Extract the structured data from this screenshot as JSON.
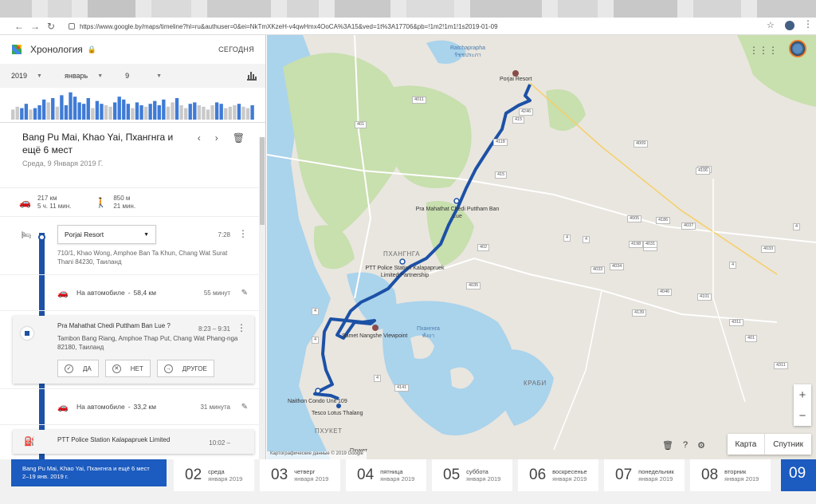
{
  "browser": {
    "url": "https://www.google.by/maps/timeline?hl=ru&authuser=0&ei=NkTmXKzeH-v4qwHmx4OoCA%3A15&ved=1t%3A17706&pb=!1m2!1m1!1s2019-01-09"
  },
  "header": {
    "title": "Хронология",
    "today_label": "СЕГОДНЯ"
  },
  "selectors": {
    "year": "2019",
    "month": "январь",
    "day": "9"
  },
  "histogram": {
    "values": [
      0.35,
      0.45,
      0.4,
      0.55,
      0.35,
      0.4,
      0.5,
      0.7,
      0.6,
      0.75,
      0.45,
      0.85,
      0.5,
      0.95,
      0.8,
      0.6,
      0.55,
      0.75,
      0.4,
      0.65,
      0.55,
      0.5,
      0.45,
      0.6,
      0.8,
      0.7,
      0.55,
      0.4,
      0.6,
      0.5,
      0.45,
      0.55,
      0.65,
      0.5,
      0.7,
      0.45,
      0.6,
      0.75,
      0.5,
      0.4,
      0.55,
      0.6,
      0.5,
      0.45,
      0.35,
      0.5,
      0.6,
      0.55,
      0.4,
      0.45,
      0.5,
      0.55,
      0.45,
      0.4,
      0.5
    ],
    "highlight": [
      false,
      false,
      true,
      true,
      false,
      true,
      true,
      true,
      false,
      true,
      false,
      true,
      true,
      true,
      true,
      true,
      true,
      true,
      false,
      true,
      true,
      false,
      false,
      true,
      true,
      true,
      true,
      false,
      true,
      true,
      false,
      true,
      true,
      true,
      true,
      false,
      false,
      true,
      false,
      false,
      true,
      true,
      false,
      false,
      false,
      false,
      true,
      true,
      false,
      false,
      false,
      true,
      false,
      false,
      true
    ]
  },
  "day": {
    "title": "Bang Pu Mai, Khao Yai, Пхангнга и ещё 6 мест",
    "date": "Среда, 9 Января 2019 Г.",
    "drive_distance": "217 км",
    "drive_duration": "5 ч. 11 мин.",
    "walk_distance": "850 м",
    "walk_duration": "21 мин."
  },
  "timeline": {
    "place1": {
      "name": "Porjai Resort",
      "time": "7:28",
      "address": "710/1, Khao Wong, Amphoe Ban Ta Khun, Chang Wat Surat Thani 84230, Таиланд"
    },
    "move1": {
      "label": "На автомобиле",
      "distance": "58,4 км",
      "duration": "55 минут"
    },
    "place2": {
      "name": "Pra Mahathat Chedi Puttham Ban Lue ?",
      "time": "8:23 – 9:31",
      "address": "Tambon Bang Riang, Amphoe Thap Put, Chang Wat Phang-nga 82180, Таиланд",
      "btn_yes": "ДА",
      "btn_no": "НЕТ",
      "btn_other": "ДРУГОЕ"
    },
    "move2": {
      "label": "На автомобиле",
      "distance": "33,2 км",
      "duration": "31 минута"
    },
    "place3": {
      "name": "PTT Police Station Kalapapruek Limited",
      "time": "10:02 –"
    }
  },
  "map": {
    "labels": {
      "ratchaprapha": "Ratchaprapha",
      "ratchaprapha_th": "รัชชประภา",
      "porjai": "Porjai Resort",
      "pra_mahathat": "Pra Mahathat Chedi Puttham Ban Lue",
      "phangnga_region": "ПХАНГНГА",
      "ptt": "PTT Police Station Kalapapruek Limited Partnership",
      "samet": "Samet Nangshe Viewpoint",
      "phangnga_bay": "Пхангнга",
      "phangnga_bay_th": "พังงา",
      "krabi": "КРАБИ",
      "naithon": "Naithon Condo Unit 109",
      "tesco": "Tesco Lotus Thalang",
      "phuket": "ПХУКЕТ",
      "phuket_city": "Пхукет",
      "copyright": "Картографические данные © 2019 Google"
    },
    "road_numbers": [
      "4246",
      "415",
      "401",
      "4011",
      "415",
      "4118",
      "4009",
      "4035",
      "4106",
      "4005",
      "4037",
      "4",
      "4186",
      "4198",
      "4034",
      "4033",
      "4035",
      "402",
      "4",
      "4031",
      "4031",
      "4",
      "4033",
      "4139",
      "4046",
      "4101",
      "4",
      "4311",
      "4311",
      "401",
      "4141",
      "4",
      "4",
      "4"
    ],
    "type_map": "Карта",
    "type_satellite": "Спутник",
    "zoom_in": "+",
    "zoom_out": "−"
  },
  "bottom": {
    "trip_title": "Bang Pu Mai, Khao Yai, Пхангнга и ещё 6 мест",
    "trip_dates": "2–19 янв. 2019 г.",
    "days": [
      {
        "num": "02",
        "weekday": "среда",
        "date": "января 2019"
      },
      {
        "num": "03",
        "weekday": "четверг",
        "date": "января 2019"
      },
      {
        "num": "04",
        "weekday": "пятница",
        "date": "января 2019"
      },
      {
        "num": "05",
        "weekday": "суббота",
        "date": "января 2019"
      },
      {
        "num": "06",
        "weekday": "воскресенье",
        "date": "января 2019"
      },
      {
        "num": "07",
        "weekday": "понедельник",
        "date": "января 2019"
      },
      {
        "num": "08",
        "weekday": "вторник",
        "date": "января 2019"
      }
    ],
    "active_day": "09"
  },
  "colors": {
    "route": "#1c51a6",
    "accent": "#1c5bbf",
    "map_bg": "#e9e6df",
    "forest": "#c8dfae",
    "water": "#aad3ec"
  }
}
